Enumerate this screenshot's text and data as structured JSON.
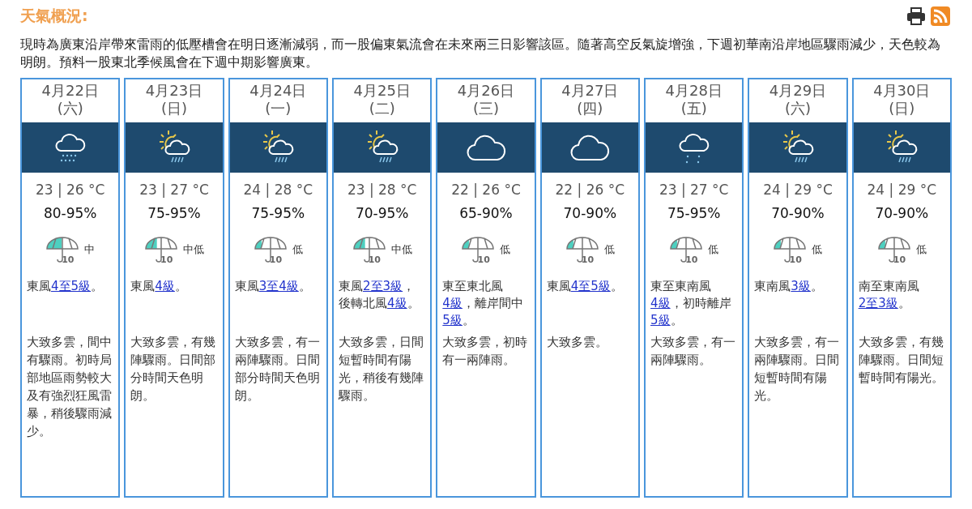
{
  "title": "天氣概況:",
  "summary": "現時為廣東沿岸帶來雷雨的低壓槽會在明日逐漸減弱，而一股偏東氣流會在未來兩三日影響該區。隨著高空反氣旋增強，下週初華南沿岸地區驟雨減少，天色較為明朗。預料一股東北季候風會在下週中期影響廣東。",
  "days": [
    {
      "date": "4月22日",
      "weekday": "(六)",
      "kind": "rain",
      "temp": "23 | 26 °C",
      "humidity": "80-95%",
      "level": 0.5,
      "psr_scale": "10",
      "psr": "中",
      "wind": [
        {
          "text": "東風",
          "kind": "text"
        },
        {
          "text": "4至5級",
          "kind": "link"
        },
        {
          "text": "。",
          "kind": "text"
        }
      ],
      "description": "大致多雲，間中有驟雨。初時局部地區雨勢較大及有強烈狂風雷暴，稍後驟雨減少。"
    },
    {
      "date": "4月23日",
      "weekday": "(日)",
      "kind": "sun-showers",
      "temp": "23 | 27 °C",
      "humidity": "75-95%",
      "level": 0.38,
      "psr_scale": "10",
      "psr": "中低",
      "wind": [
        {
          "text": "東風",
          "kind": "text"
        },
        {
          "text": "4級",
          "kind": "link"
        },
        {
          "text": "。",
          "kind": "text"
        }
      ],
      "description": "大致多雲，有幾陣驟雨。日間部分時間天色明朗。"
    },
    {
      "date": "4月24日",
      "weekday": "(一)",
      "kind": "sun-showers",
      "temp": "24 | 28 °C",
      "humidity": "75-95%",
      "level": 0.22,
      "psr_scale": "10",
      "psr": "低",
      "wind": [
        {
          "text": "東風",
          "kind": "text"
        },
        {
          "text": "3至4級",
          "kind": "link"
        },
        {
          "text": "。",
          "kind": "text"
        }
      ],
      "description": "大致多雲，有一兩陣驟雨。日間部分時間天色明朗。"
    },
    {
      "date": "4月25日",
      "weekday": "(二)",
      "kind": "sun-showers",
      "temp": "23 | 28 °C",
      "humidity": "70-95%",
      "level": 0.38,
      "psr_scale": "10",
      "psr": "中低",
      "wind": [
        {
          "text": "東風",
          "kind": "text"
        },
        {
          "text": "2至3級",
          "kind": "link"
        },
        {
          "text": "，後轉北風",
          "kind": "text"
        },
        {
          "text": "4級",
          "kind": "link"
        },
        {
          "text": "。",
          "kind": "text"
        }
      ],
      "description": "大致多雲，日間短暫時間有陽光，稍後有幾陣驟雨。"
    },
    {
      "date": "4月26日",
      "weekday": "(三)",
      "kind": "cloudy",
      "temp": "22 | 26 °C",
      "humidity": "65-90%",
      "level": 0.22,
      "psr_scale": "10",
      "psr": "低",
      "wind": [
        {
          "text": "東至東北風",
          "kind": "text"
        },
        {
          "text": "4級",
          "kind": "link"
        },
        {
          "text": "，離岸間中",
          "kind": "text"
        },
        {
          "text": "5級",
          "kind": "link"
        },
        {
          "text": "。",
          "kind": "text"
        }
      ],
      "description": "大致多雲，初時有一兩陣雨。"
    },
    {
      "date": "4月27日",
      "weekday": "(四)",
      "kind": "cloudy",
      "temp": "22 | 26 °C",
      "humidity": "70-90%",
      "level": 0.22,
      "psr_scale": "10",
      "psr": "低",
      "wind": [
        {
          "text": "東風",
          "kind": "text"
        },
        {
          "text": "4至5級",
          "kind": "link"
        },
        {
          "text": "。",
          "kind": "text"
        }
      ],
      "description": "大致多雲。"
    },
    {
      "date": "4月28日",
      "weekday": "(五)",
      "kind": "light-rain",
      "temp": "23 | 27 °C",
      "humidity": "75-95%",
      "level": 0.22,
      "psr_scale": "10",
      "psr": "低",
      "wind": [
        {
          "text": "東至東南風",
          "kind": "text"
        },
        {
          "text": "4級",
          "kind": "link"
        },
        {
          "text": "，初時離岸",
          "kind": "text"
        },
        {
          "text": "5級",
          "kind": "link"
        },
        {
          "text": "。",
          "kind": "text"
        }
      ],
      "description": "大致多雲，有一兩陣驟雨。"
    },
    {
      "date": "4月29日",
      "weekday": "(六)",
      "kind": "sun-showers",
      "temp": "24 | 29 °C",
      "humidity": "70-90%",
      "level": 0.22,
      "psr_scale": "10",
      "psr": "低",
      "wind": [
        {
          "text": "東南風",
          "kind": "text"
        },
        {
          "text": "3級",
          "kind": "link"
        },
        {
          "text": "。",
          "kind": "text"
        }
      ],
      "description": "大致多雲，有一兩陣驟雨。日間短暫時間有陽光。"
    },
    {
      "date": "4月30日",
      "weekday": "(日)",
      "kind": "sun-showers",
      "temp": "24 | 29 °C",
      "humidity": "70-90%",
      "level": 0.22,
      "psr_scale": "10",
      "psr": "低",
      "wind": [
        {
          "text": "南至東南風",
          "kind": "text"
        },
        {
          "text": "2至3級",
          "kind": "link"
        },
        {
          "text": "。",
          "kind": "text"
        }
      ],
      "description": "大致多雲，有幾陣驟雨。日間短暫時間有陽光。"
    }
  ]
}
